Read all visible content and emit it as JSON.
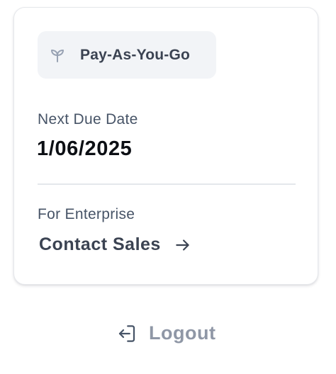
{
  "plan": {
    "label": "Pay-As-You-Go",
    "icon": "sprout-icon"
  },
  "billing": {
    "due_label": "Next Due Date",
    "due_value": "1/06/2025"
  },
  "enterprise": {
    "label": "For Enterprise",
    "link_label": "Contact Sales",
    "link_icon": "arrow-right-icon"
  },
  "logout": {
    "label": "Logout",
    "icon": "logout-icon"
  },
  "colors": {
    "text_dark": "#0c0f14",
    "text_primary": "#3b4352",
    "text_muted": "#475467",
    "logout_text": "#8f97a6",
    "badge_bg": "#f2f4f7",
    "icon_muted": "#98a2b3",
    "divider": "#e4e7ec"
  }
}
